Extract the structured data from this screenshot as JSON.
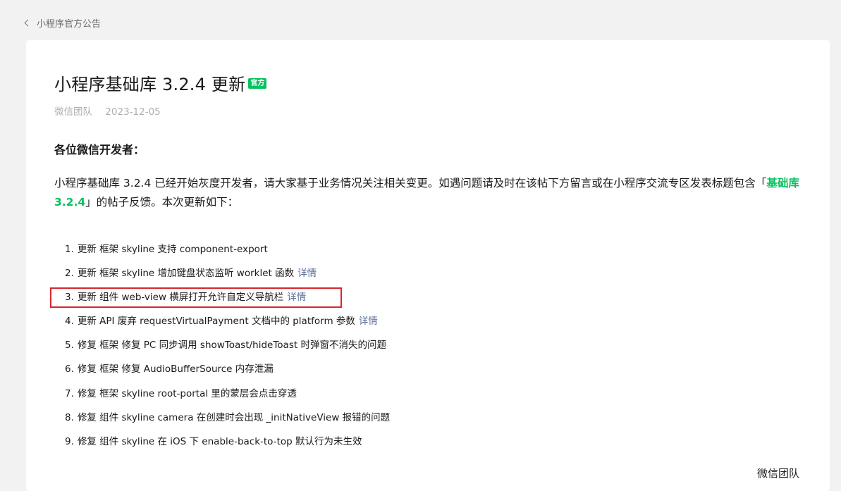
{
  "nav": {
    "back_label": "小程序官方公告"
  },
  "post": {
    "title": "小程序基础库 3.2.4 更新",
    "badge": "官方",
    "author": "微信团队",
    "date": "2023-12-05",
    "greeting": "各位微信开发者：",
    "intro_before": "小程序基础库 3.2.4 已经开始灰度开发者，请大家基于业务情况关注相关变更。如遇问题请及时在该帖下方留言或在小程序交流专区发表标题包含「",
    "intro_highlight": "基础库3.2.4",
    "intro_after": "」的帖子反馈。本次更新如下：",
    "signature": "微信团队"
  },
  "updates": [
    {
      "num": "1.",
      "text": "更新 框架 skyline 支持 component-export",
      "detail": ""
    },
    {
      "num": "2.",
      "text": "更新 框架 skyline 增加键盘状态监听 worklet 函数",
      "detail": "详情"
    },
    {
      "num": "3.",
      "text": "更新 组件 web-view 横屏打开允许自定义导航栏",
      "detail": "详情"
    },
    {
      "num": "4.",
      "text": "更新 API 废弃 requestVirtualPayment 文档中的 platform 参数",
      "detail": "详情"
    },
    {
      "num": "5.",
      "text": "修复 框架 修复 PC 同步调用 showToast/hideToast 时弹窗不消失的问题",
      "detail": ""
    },
    {
      "num": "6.",
      "text": "修复 框架 修复 AudioBufferSource 内存泄漏",
      "detail": ""
    },
    {
      "num": "7.",
      "text": "修复 框架 skyline root-portal 里的蒙层会点击穿透",
      "detail": ""
    },
    {
      "num": "8.",
      "text": "修复 组件 skyline camera 在创建时会出现 _initNativeView 报错的问题",
      "detail": ""
    },
    {
      "num": "9.",
      "text": "修复 组件 skyline 在 iOS 下 enable-back-to-top 默认行为未生效",
      "detail": ""
    }
  ],
  "colors": {
    "accent_green": "#07c160",
    "link_blue": "#576b95",
    "annotation_red": "#d9262c"
  }
}
